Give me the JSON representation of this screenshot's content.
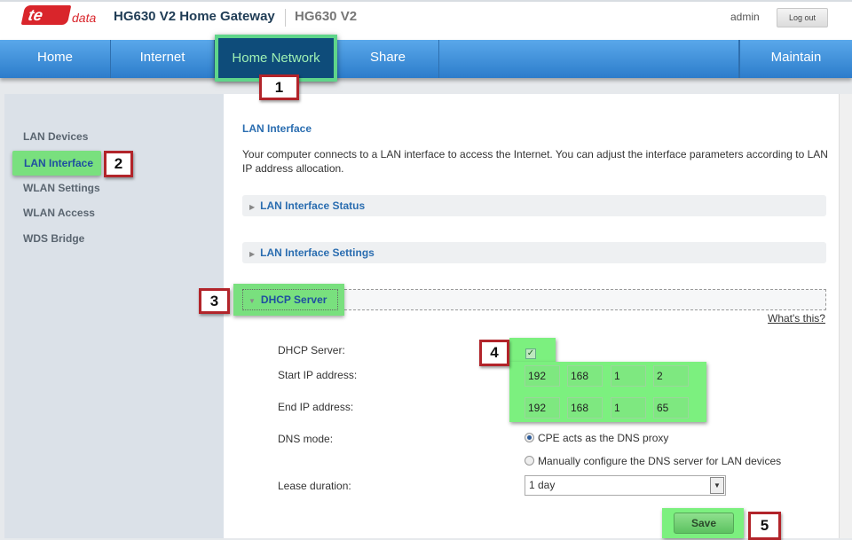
{
  "header": {
    "logo_text": "te data",
    "title": "HG630 V2 Home Gateway",
    "model": "HG630 V2",
    "user": "admin",
    "logout": "Log out"
  },
  "nav": {
    "items": [
      "Home",
      "Internet",
      "Home Network",
      "Share",
      "Maintain"
    ],
    "active": "Home Network"
  },
  "sidebar": {
    "items": [
      "LAN Devices",
      "LAN Interface",
      "WLAN Settings",
      "WLAN Access",
      "WDS Bridge"
    ],
    "active": "LAN Interface"
  },
  "content": {
    "heading": "LAN Interface",
    "description": "Your computer connects to a LAN interface to access the Internet. You can adjust the interface parameters according to LAN IP address allocation.",
    "panels": [
      "LAN Interface Status",
      "LAN Interface Settings"
    ],
    "dhcp_section": "DHCP Server",
    "whats_this": "What's this?",
    "form": {
      "dhcp_label": "DHCP Server:",
      "dhcp_enabled": true,
      "start_label": "Start IP address:",
      "start_ip": [
        "192",
        "168",
        "1",
        "2"
      ],
      "end_label": "End IP address:",
      "end_ip": [
        "192",
        "168",
        "1",
        "65"
      ],
      "dns_label": "DNS mode:",
      "dns_options": [
        "CPE acts as the DNS proxy",
        "Manually configure the DNS server for LAN devices"
      ],
      "dns_selected": "CPE acts as the DNS proxy",
      "lease_label": "Lease duration:",
      "lease_value": "1 day",
      "save": "Save"
    }
  },
  "callouts": [
    "1",
    "2",
    "3",
    "4",
    "5"
  ],
  "colors": {
    "highlight": "#7cf07f",
    "callout_border": "#b2242a",
    "nav_blue": "#3d8fd8",
    "nav_active": "#0e4c7a"
  }
}
